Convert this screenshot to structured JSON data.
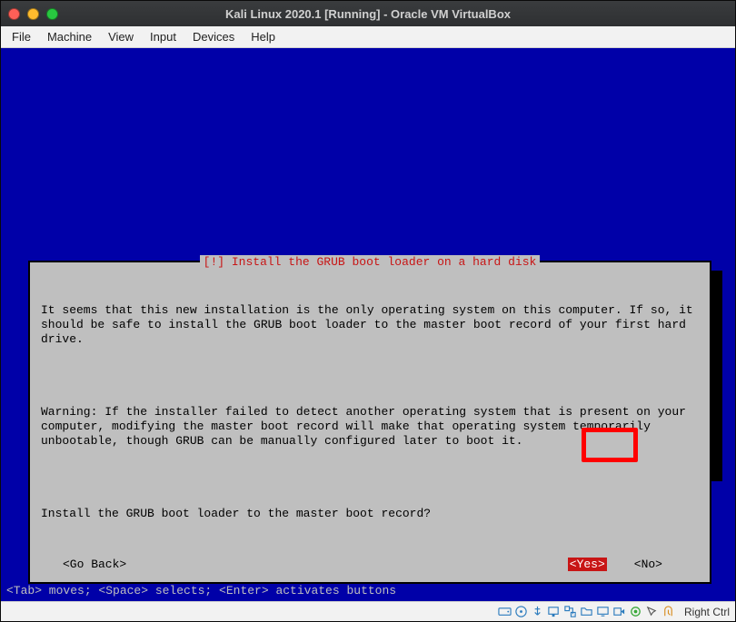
{
  "window": {
    "title": "Kali Linux 2020.1 [Running] - Oracle VM VirtualBox"
  },
  "menubar": {
    "file": "File",
    "machine": "Machine",
    "view": "View",
    "input": "Input",
    "devices": "Devices",
    "help": "Help"
  },
  "dialog": {
    "title": "[!] Install the GRUB boot loader on a hard disk",
    "para1": "It seems that this new installation is the only operating system on this computer. If so, it should be safe to install the GRUB boot loader to the master boot record of your first hard drive.",
    "para2": "Warning: If the installer failed to detect another operating system that is present on your computer, modifying the master boot record will make that operating system temporarily unbootable, though GRUB can be manually configured later to boot it.",
    "question": "Install the GRUB boot loader to the master boot record?",
    "go_back": "<Go Back>",
    "yes": "<Yes>",
    "no": "<No>"
  },
  "hint": "<Tab> moves; <Space> selects; <Enter> activates buttons",
  "statusbar": {
    "hostkey": "Right Ctrl"
  }
}
